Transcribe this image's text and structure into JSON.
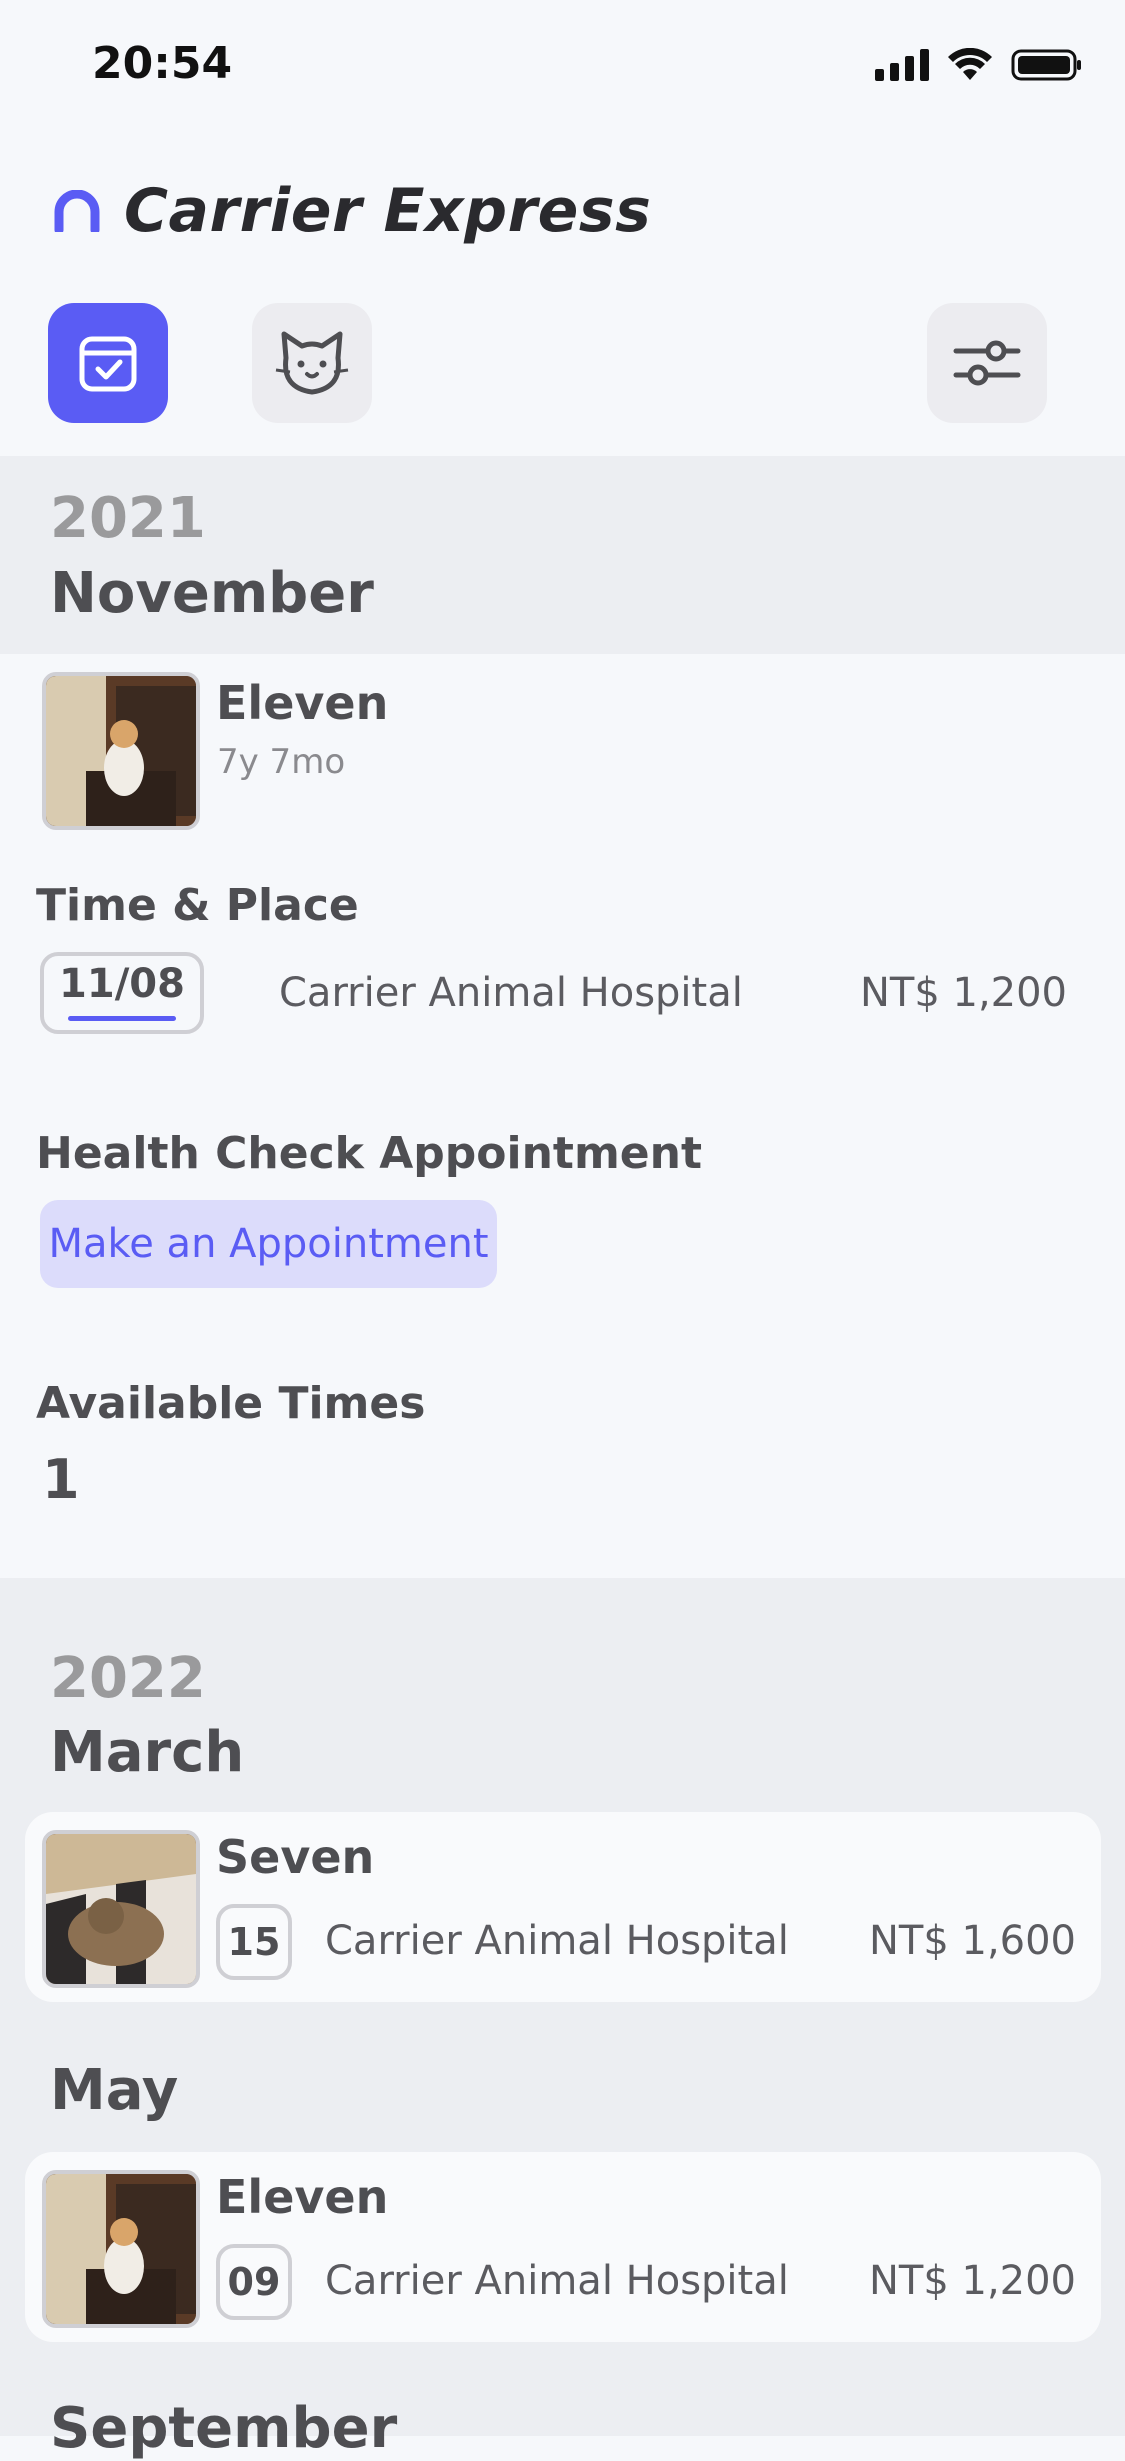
{
  "status_bar": {
    "time": "20:54"
  },
  "header": {
    "app_title": "Carrier Express"
  },
  "toolbar": {
    "buttons": [
      {
        "icon": "calendar-check-icon",
        "active": true
      },
      {
        "icon": "cat-icon",
        "active": false
      },
      {
        "icon": "sliders-icon",
        "active": false
      }
    ]
  },
  "colors": {
    "accent": "#5a5cf4",
    "accent_soft": "#dcdcfb",
    "band": "#eceef2"
  },
  "section_2021": {
    "year": "2021",
    "month": "November",
    "pet": {
      "name": "Eleven",
      "age": "7y 7mo"
    },
    "time_place_label": "Time & Place",
    "date": "11/08",
    "place": "Carrier Animal Hospital",
    "price": "NT$ 1,200",
    "health_label": "Health Check Appointment",
    "appointment_button": "Make an Appointment",
    "available_label": "Available Times",
    "available_count": "1"
  },
  "section_2022": {
    "year": "2022",
    "months": [
      {
        "month": "March",
        "pet": "Seven",
        "day": "15",
        "place": "Carrier Animal Hospital",
        "price": "NT$ 1,600"
      },
      {
        "month": "May",
        "pet": "Eleven",
        "day": "09",
        "place": "Carrier Animal Hospital",
        "price": "NT$ 1,200"
      }
    ],
    "next_month": "September"
  }
}
